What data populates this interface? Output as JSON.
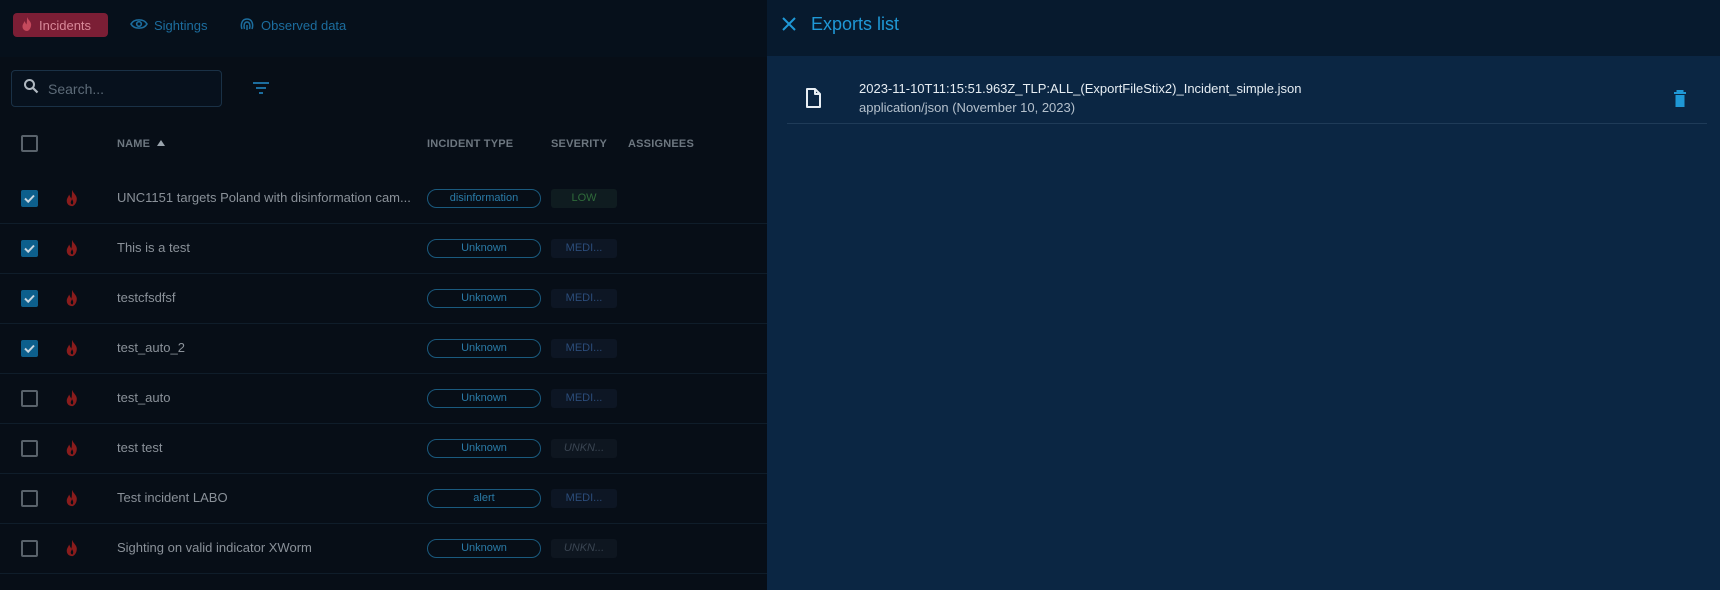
{
  "tabs": [
    {
      "label": "Incidents",
      "icon": "fire-icon",
      "active": true
    },
    {
      "label": "Sightings",
      "icon": "eye-icon",
      "active": false
    },
    {
      "label": "Observed data",
      "icon": "fingerprint-icon",
      "active": false
    }
  ],
  "search": {
    "placeholder": "Search..."
  },
  "table": {
    "columns": {
      "name": "NAME",
      "incident_type": "INCIDENT TYPE",
      "severity": "SEVERITY",
      "assignees": "ASSIGNEES"
    },
    "rows": [
      {
        "checked": true,
        "name": "UNC1151 targets Poland with disinformation cam...",
        "type": "disinformation",
        "severity": "LOW",
        "severity_level": "low"
      },
      {
        "checked": true,
        "name": "This is a test",
        "type": "Unknown",
        "severity": "MEDI...",
        "severity_level": "medium"
      },
      {
        "checked": true,
        "name": "testcfsdfsf",
        "type": "Unknown",
        "severity": "MEDI...",
        "severity_level": "medium"
      },
      {
        "checked": true,
        "name": "test_auto_2",
        "type": "Unknown",
        "severity": "MEDI...",
        "severity_level": "medium"
      },
      {
        "checked": false,
        "name": "test_auto",
        "type": "Unknown",
        "severity": "MEDI...",
        "severity_level": "medium"
      },
      {
        "checked": false,
        "name": "test test",
        "type": "Unknown",
        "severity": "UNKN...",
        "severity_level": "unknown"
      },
      {
        "checked": false,
        "name": "Test incident LABO",
        "type": "alert",
        "severity": "MEDI...",
        "severity_level": "medium"
      },
      {
        "checked": false,
        "name": "Sighting on valid indicator XWorm",
        "type": "Unknown",
        "severity": "UNKN...",
        "severity_level": "unknown"
      }
    ]
  },
  "drawer": {
    "title": "Exports list",
    "exports": [
      {
        "file_name": "2023-11-10T11:15:51.963Z_TLP:ALL_(ExportFileStix2)_Incident_simple.json",
        "meta": "application/json (November 10, 2023)"
      }
    ]
  },
  "colors": {
    "accent": "#1f98d6",
    "incident_tab_bg": "#7b1e35",
    "drawer_bg": "#0b2643",
    "fire_icon": "#8a1c1c"
  }
}
